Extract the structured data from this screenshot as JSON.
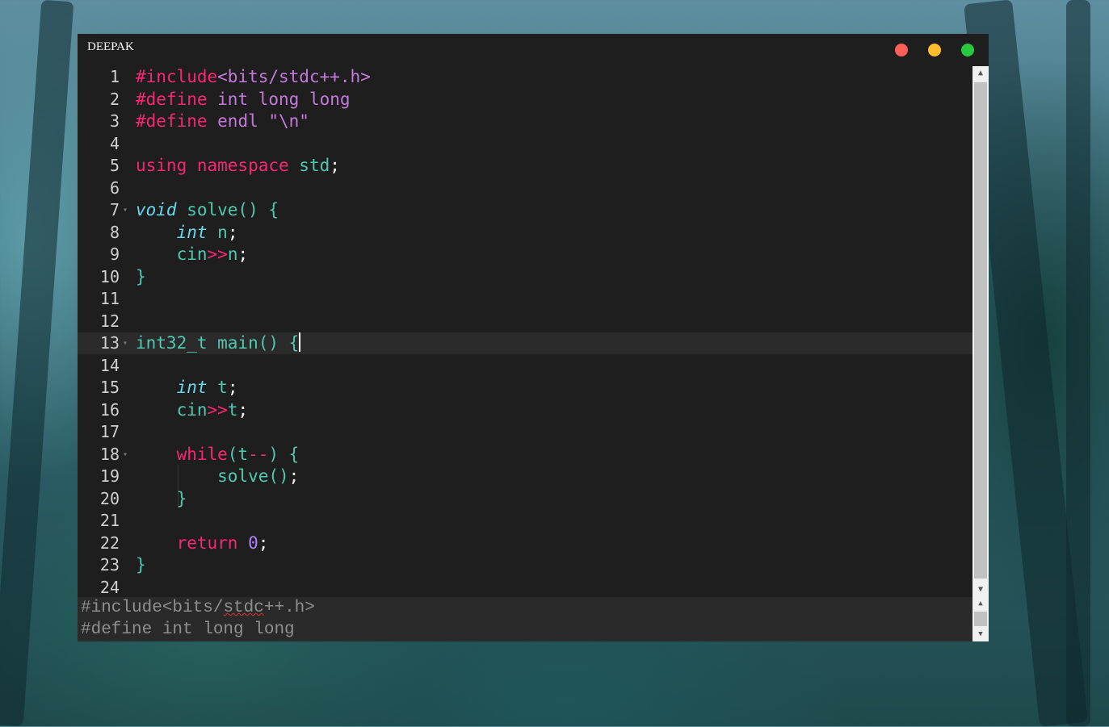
{
  "window": {
    "title": "DEEPAK",
    "controls": [
      {
        "name": "close",
        "color": "#ff5f56"
      },
      {
        "name": "minimize",
        "color": "#ffbd2e"
      },
      {
        "name": "maximize",
        "color": "#27c93f"
      }
    ]
  },
  "colors": {
    "background": "#1e1e1e",
    "preprocessor": "#f92672",
    "include_path": "#ae81ff",
    "keyword": "#f92672",
    "type": "#66d9ef",
    "identifier": "#4ec9b0",
    "number": "#ae81ff",
    "plain": "#f8f8f2"
  },
  "editor": {
    "active_line": 13,
    "lines": [
      {
        "n": "1",
        "fold": false,
        "tokens": [
          {
            "t": "#include",
            "c": "#f92672"
          },
          {
            "t": "<bits/stdc++.h>",
            "c": "#c678dd"
          }
        ]
      },
      {
        "n": "2",
        "fold": false,
        "tokens": [
          {
            "t": "#define ",
            "c": "#f92672"
          },
          {
            "t": "int long long",
            "c": "#c678dd"
          }
        ]
      },
      {
        "n": "3",
        "fold": false,
        "tokens": [
          {
            "t": "#define ",
            "c": "#f92672"
          },
          {
            "t": "endl \"\\n\"",
            "c": "#c678dd"
          }
        ]
      },
      {
        "n": "4",
        "fold": false,
        "tokens": []
      },
      {
        "n": "5",
        "fold": false,
        "tokens": [
          {
            "t": "using namespace ",
            "c": "#f92672"
          },
          {
            "t": "std",
            "c": "#4ec9b0"
          },
          {
            "t": ";",
            "c": "#f8f8f2"
          }
        ]
      },
      {
        "n": "6",
        "fold": false,
        "tokens": []
      },
      {
        "n": "7",
        "fold": true,
        "tokens": [
          {
            "t": "void",
            "c": "#66d9ef",
            "i": true
          },
          {
            "t": " solve() {",
            "c": "#4ec9b0"
          }
        ]
      },
      {
        "n": "8",
        "fold": false,
        "tokens": [
          {
            "t": "    ",
            "c": "#f8f8f2"
          },
          {
            "t": "int",
            "c": "#66d9ef",
            "i": true
          },
          {
            "t": " n",
            "c": "#4ec9b0"
          },
          {
            "t": ";",
            "c": "#f8f8f2"
          }
        ]
      },
      {
        "n": "9",
        "fold": false,
        "tokens": [
          {
            "t": "    cin",
            "c": "#4ec9b0"
          },
          {
            "t": ">>",
            "c": "#f92672"
          },
          {
            "t": "n",
            "c": "#4ec9b0"
          },
          {
            "t": ";",
            "c": "#f8f8f2"
          }
        ]
      },
      {
        "n": "10",
        "fold": false,
        "tokens": [
          {
            "t": "}",
            "c": "#4ec9b0"
          }
        ]
      },
      {
        "n": "11",
        "fold": false,
        "tokens": []
      },
      {
        "n": "12",
        "fold": false,
        "tokens": []
      },
      {
        "n": "13",
        "fold": true,
        "tokens": [
          {
            "t": "int32_t main() {",
            "c": "#4ec9b0"
          }
        ],
        "caret": true
      },
      {
        "n": "14",
        "fold": false,
        "tokens": []
      },
      {
        "n": "15",
        "fold": false,
        "tokens": [
          {
            "t": "    ",
            "c": "#f8f8f2"
          },
          {
            "t": "int",
            "c": "#66d9ef",
            "i": true
          },
          {
            "t": " t",
            "c": "#4ec9b0"
          },
          {
            "t": ";",
            "c": "#f8f8f2"
          }
        ]
      },
      {
        "n": "16",
        "fold": false,
        "tokens": [
          {
            "t": "    cin",
            "c": "#4ec9b0"
          },
          {
            "t": ">>",
            "c": "#f92672"
          },
          {
            "t": "t",
            "c": "#4ec9b0"
          },
          {
            "t": ";",
            "c": "#f8f8f2"
          }
        ]
      },
      {
        "n": "17",
        "fold": false,
        "tokens": []
      },
      {
        "n": "18",
        "fold": true,
        "tokens": [
          {
            "t": "    ",
            "c": "#f8f8f2"
          },
          {
            "t": "while",
            "c": "#f92672"
          },
          {
            "t": "(t",
            "c": "#4ec9b0"
          },
          {
            "t": "--",
            "c": "#f92672"
          },
          {
            "t": ") {",
            "c": "#4ec9b0"
          }
        ]
      },
      {
        "n": "19",
        "fold": false,
        "tokens": [
          {
            "t": "        solve()",
            "c": "#4ec9b0"
          },
          {
            "t": ";",
            "c": "#f8f8f2"
          }
        ]
      },
      {
        "n": "20",
        "fold": false,
        "tokens": [
          {
            "t": "    }",
            "c": "#4ec9b0"
          }
        ]
      },
      {
        "n": "21",
        "fold": false,
        "tokens": []
      },
      {
        "n": "22",
        "fold": false,
        "tokens": [
          {
            "t": "    ",
            "c": "#f8f8f2"
          },
          {
            "t": "return ",
            "c": "#f92672"
          },
          {
            "t": "0",
            "c": "#ae81ff"
          },
          {
            "t": ";",
            "c": "#f8f8f2"
          }
        ]
      },
      {
        "n": "23",
        "fold": false,
        "tokens": [
          {
            "t": "}",
            "c": "#4ec9b0"
          }
        ]
      },
      {
        "n": "24",
        "fold": false,
        "tokens": []
      }
    ]
  },
  "input_pane": {
    "line1_prefix": "#include<bits/",
    "line1_squiggle": "stdc",
    "line1_suffix": "++.h>",
    "line2": "#define int long long"
  },
  "scrollbar": {
    "up_icon": "▲",
    "down_icon": "▼"
  }
}
